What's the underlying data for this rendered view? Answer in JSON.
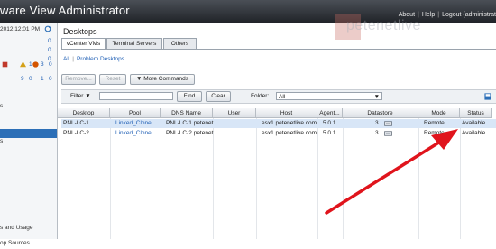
{
  "app": {
    "title": "ware View Administrator"
  },
  "toplinks": {
    "about": "About",
    "help": "Help",
    "logout": "Logout (administrat"
  },
  "left": {
    "date": "2012 12:01 PM",
    "counts": [
      "0",
      "0",
      "0"
    ],
    "alerts": [
      "1",
      "3",
      "0"
    ],
    "icons_row": [
      "9",
      "0",
      "1",
      "0"
    ],
    "nav": [
      "s",
      "",
      "s",
      "",
      "",
      "",
      "",
      "",
      "s and Usage",
      "",
      "op Sources",
      ""
    ]
  },
  "page": {
    "title": "Desktops"
  },
  "tabs": [
    {
      "label": "vCenter VMs",
      "active": true
    },
    {
      "label": "Terminal Servers",
      "active": false
    },
    {
      "label": "Others",
      "active": false
    }
  ],
  "filters": {
    "all": "All",
    "problem": "Problem Desktops"
  },
  "actions": {
    "remove": "Remove...",
    "reset": "Reset",
    "more": "More Commands"
  },
  "toolbar": {
    "filter_label": "Filter",
    "find": "Find",
    "clear": "Clear",
    "folder_label": "Folder:",
    "folder_value": "All"
  },
  "grid": {
    "headers": [
      "Desktop",
      "Pool",
      "DNS Name",
      "User",
      "Host",
      "Agent...",
      "Datastore",
      "Mode",
      "Status"
    ],
    "rows": [
      {
        "desktop": "PNL-LC-1",
        "pool": "Linked_Clone",
        "dns": "PNL-LC-1.petenet",
        "user": "",
        "host": "esx1.petenetlive.com",
        "agent": "5.0.1",
        "datastore": "3",
        "mode": "Remote",
        "status": "Available"
      },
      {
        "desktop": "PNL-LC-2",
        "pool": "Linked_Clone",
        "dns": "PNL-LC-2.petenet",
        "user": "",
        "host": "esx1.petenetlive.com",
        "agent": "5.0.1",
        "datastore": "3",
        "mode": "Remote",
        "status": "Available"
      }
    ]
  },
  "watermark": {
    "text": "petenetlive"
  },
  "colors": {
    "selected_nav": "#2c6fb7",
    "link": "#1f5fb5",
    "arrow": "#e0141c",
    "titlebar": "#2a2e34"
  }
}
